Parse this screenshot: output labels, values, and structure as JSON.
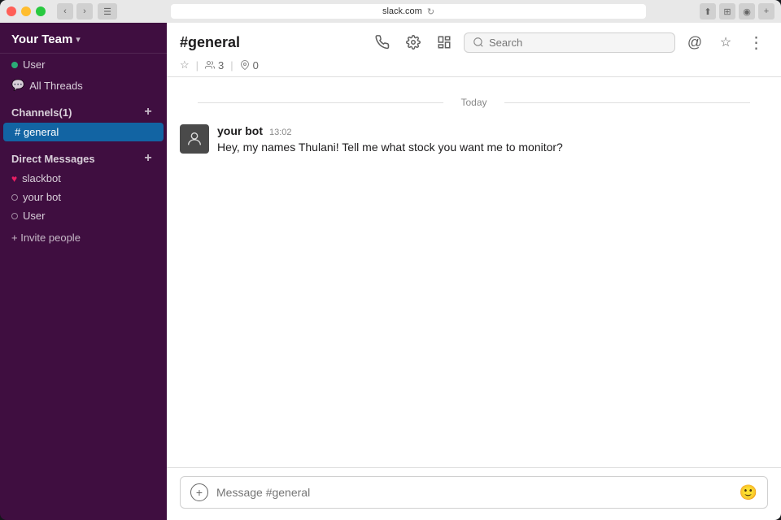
{
  "window": {
    "url": "slack.com"
  },
  "sidebar": {
    "team_name": "Your Team",
    "team_chevron": "▾",
    "user": "User",
    "all_threads": "All Threads",
    "channels_label": "Channels",
    "channels_count": "(1)",
    "channels": [
      {
        "name": "# general",
        "active": true
      }
    ],
    "direct_messages_label": "Direct Messages",
    "dm_items": [
      {
        "name": "slackbot",
        "status": "heart"
      },
      {
        "name": "your bot",
        "status": "offline"
      },
      {
        "name": "User",
        "status": "offline"
      }
    ],
    "invite_label": "+ Invite people"
  },
  "channel": {
    "title": "#general",
    "members_count": "3",
    "pins_count": "0",
    "search_placeholder": "Search"
  },
  "messages": {
    "date_divider": "Today",
    "items": [
      {
        "author": "your bot",
        "time": "13:02",
        "text": "Hey, my names Thulani! Tell me what stock you want me to monitor?"
      }
    ]
  },
  "input": {
    "placeholder": "Message #general"
  },
  "icons": {
    "phone": "📞",
    "settings": "⚙",
    "layout": "⊞",
    "search": "🔍",
    "at": "@",
    "star": "☆",
    "emoji": "🙂",
    "overflow": "•••",
    "threads_icon": "💬",
    "members_icon": "👤",
    "pin_icon": "📌"
  }
}
